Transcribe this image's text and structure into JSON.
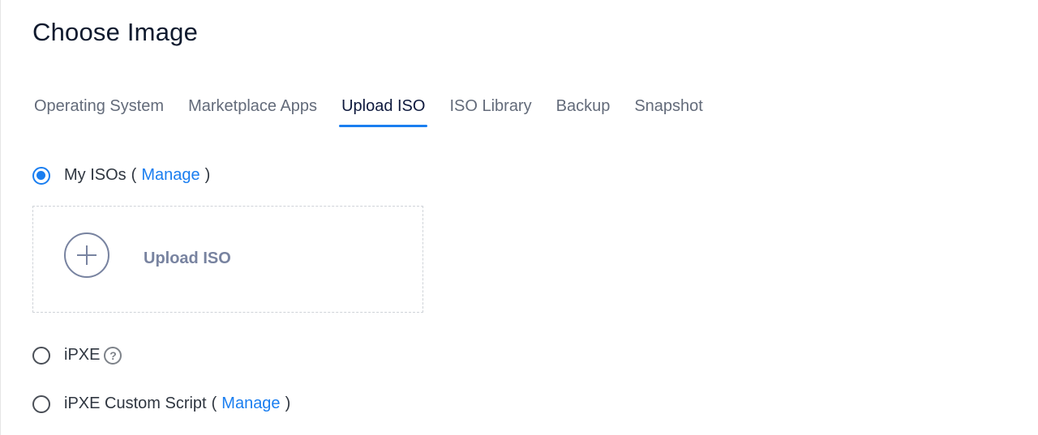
{
  "page": {
    "title": "Choose Image"
  },
  "tabs": [
    {
      "label": "Operating System",
      "active": false
    },
    {
      "label": "Marketplace Apps",
      "active": false
    },
    {
      "label": "Upload ISO",
      "active": true
    },
    {
      "label": "ISO Library",
      "active": false
    },
    {
      "label": "Backup",
      "active": false
    },
    {
      "label": "Snapshot",
      "active": false
    }
  ],
  "options": {
    "my_isos": {
      "label": "My ISOs",
      "open_paren": "(",
      "link": "Manage",
      "close_paren": ")",
      "checked": true
    },
    "upload": {
      "label": "Upload ISO",
      "icon": "plus-circle-icon"
    },
    "ipxe": {
      "label": "iPXE",
      "help_icon": "?",
      "checked": false
    },
    "ipxe_custom": {
      "label": "iPXE Custom Script",
      "open_paren": "(",
      "link": "Manage",
      "close_paren": ")",
      "checked": false
    }
  },
  "colors": {
    "accent": "#1a7ef0",
    "title": "#0f1a2e",
    "muted": "#7883a0"
  }
}
